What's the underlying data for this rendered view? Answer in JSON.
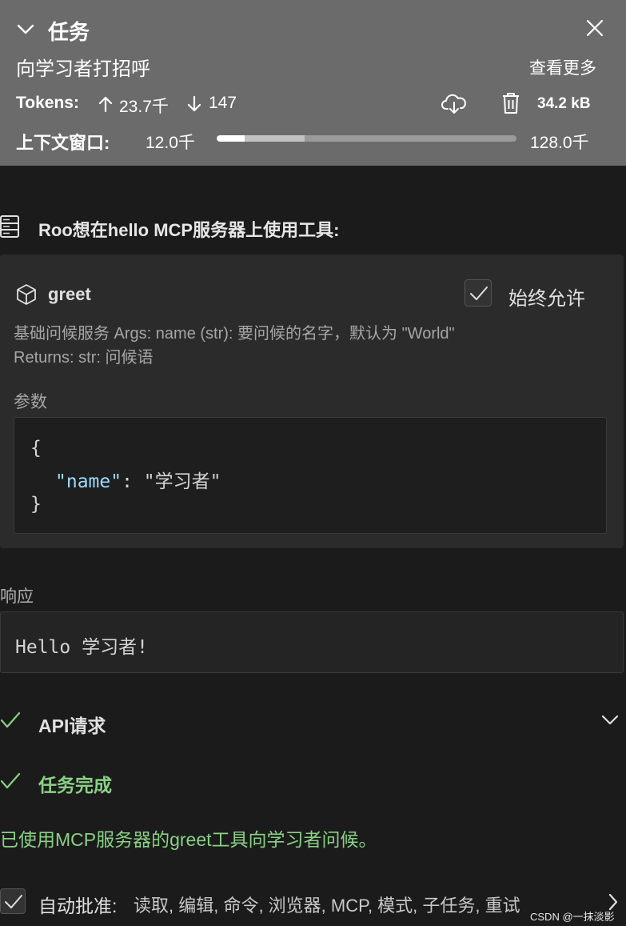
{
  "task": {
    "header_title": "任务",
    "name": "向学习者打招呼",
    "see_more": "查看更多",
    "tokens_label": "Tokens:",
    "tokens_up": "23.7千",
    "tokens_down": "147",
    "task_size": "34.2 kB",
    "context_label": "上下文窗口:",
    "context_used": "12.0千",
    "context_max": "128.0千",
    "context_fraction": 0.094
  },
  "mcp": {
    "heading": "Roo想在hello MCP服务器上使用工具:",
    "tool_name": "greet",
    "always_allow_label": "始终允许",
    "always_allow_checked": true,
    "description_line1": "基础问候服务 Args: name (str): 要问候的名字，默认为 \"World\"",
    "description_line2": "Returns: str: 问候语",
    "params_label": "参数",
    "code_open": "{",
    "code_key": "\"name\"",
    "code_sep": ": ",
    "code_value": "\"学习者\"",
    "code_close": "}"
  },
  "response": {
    "label": "响应",
    "text": "Hello 学习者!"
  },
  "api_request": {
    "label": "API请求"
  },
  "completion": {
    "label": "任务完成",
    "text": "已使用MCP服务器的greet工具向学习者问候。"
  },
  "auto_approve": {
    "label": "自动批准:",
    "items": "读取, 编辑, 命令, 浏览器, MCP, 模式, 子任务, 重试"
  },
  "watermark": "CSDN @一抹淡影",
  "colors": {
    "header_bg": "#6b6b6b",
    "page_bg": "#1b1b1b",
    "card_bg": "#2b2b2b",
    "success_green": "#89d185",
    "code_key_blue": "#9cdcfe"
  }
}
